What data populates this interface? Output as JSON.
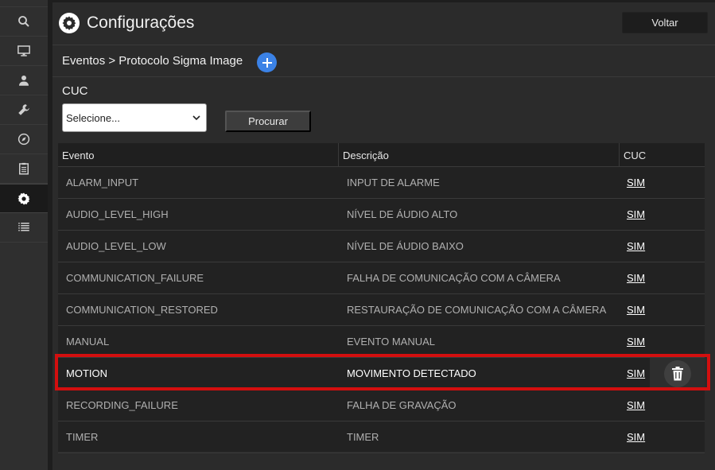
{
  "header": {
    "title": "Configurações",
    "back_label": "Voltar"
  },
  "breadcrumb": {
    "text": "Eventos > Protocolo Sigma Image",
    "add_label": "+"
  },
  "filter": {
    "label": "CUC",
    "select_value": "Selecione...",
    "search_label": "Procurar"
  },
  "table": {
    "columns": [
      "Evento",
      "Descrição",
      "CUC"
    ],
    "rows": [
      {
        "event": "ALARM_INPUT",
        "description": "INPUT DE ALARME",
        "cuc": "SIM"
      },
      {
        "event": "AUDIO_LEVEL_HIGH",
        "description": "NÍVEL DE ÁUDIO ALTO",
        "cuc": "SIM"
      },
      {
        "event": "AUDIO_LEVEL_LOW",
        "description": "NÍVEL DE ÁUDIO BAIXO",
        "cuc": "SIM"
      },
      {
        "event": "COMMUNICATION_FAILURE",
        "description": "FALHA DE COMUNICAÇÃO COM A CÂMERA",
        "cuc": "SIM"
      },
      {
        "event": "COMMUNICATION_RESTORED",
        "description": "RESTAURAÇÃO DE COMUNICAÇÃO COM A CÂMERA",
        "cuc": "SIM"
      },
      {
        "event": "MANUAL",
        "description": "EVENTO MANUAL",
        "cuc": "SIM"
      },
      {
        "event": "MOTION",
        "description": "MOVIMENTO DETECTADO",
        "cuc": "SIM"
      },
      {
        "event": "RECORDING_FAILURE",
        "description": "FALHA DE GRAVAÇÃO",
        "cuc": "SIM"
      },
      {
        "event": "TIMER",
        "description": "TIMER",
        "cuc": "SIM"
      }
    ]
  },
  "sidebar": {
    "icons": [
      "search-icon",
      "monitor-icon",
      "user-icon",
      "wrench-icon",
      "compass-icon",
      "clipboard-icon",
      "gear-icon",
      "list-icon"
    ],
    "active": "gear-icon"
  },
  "colors": {
    "accent": "#3b82e6",
    "highlight": "#d30f0f"
  }
}
